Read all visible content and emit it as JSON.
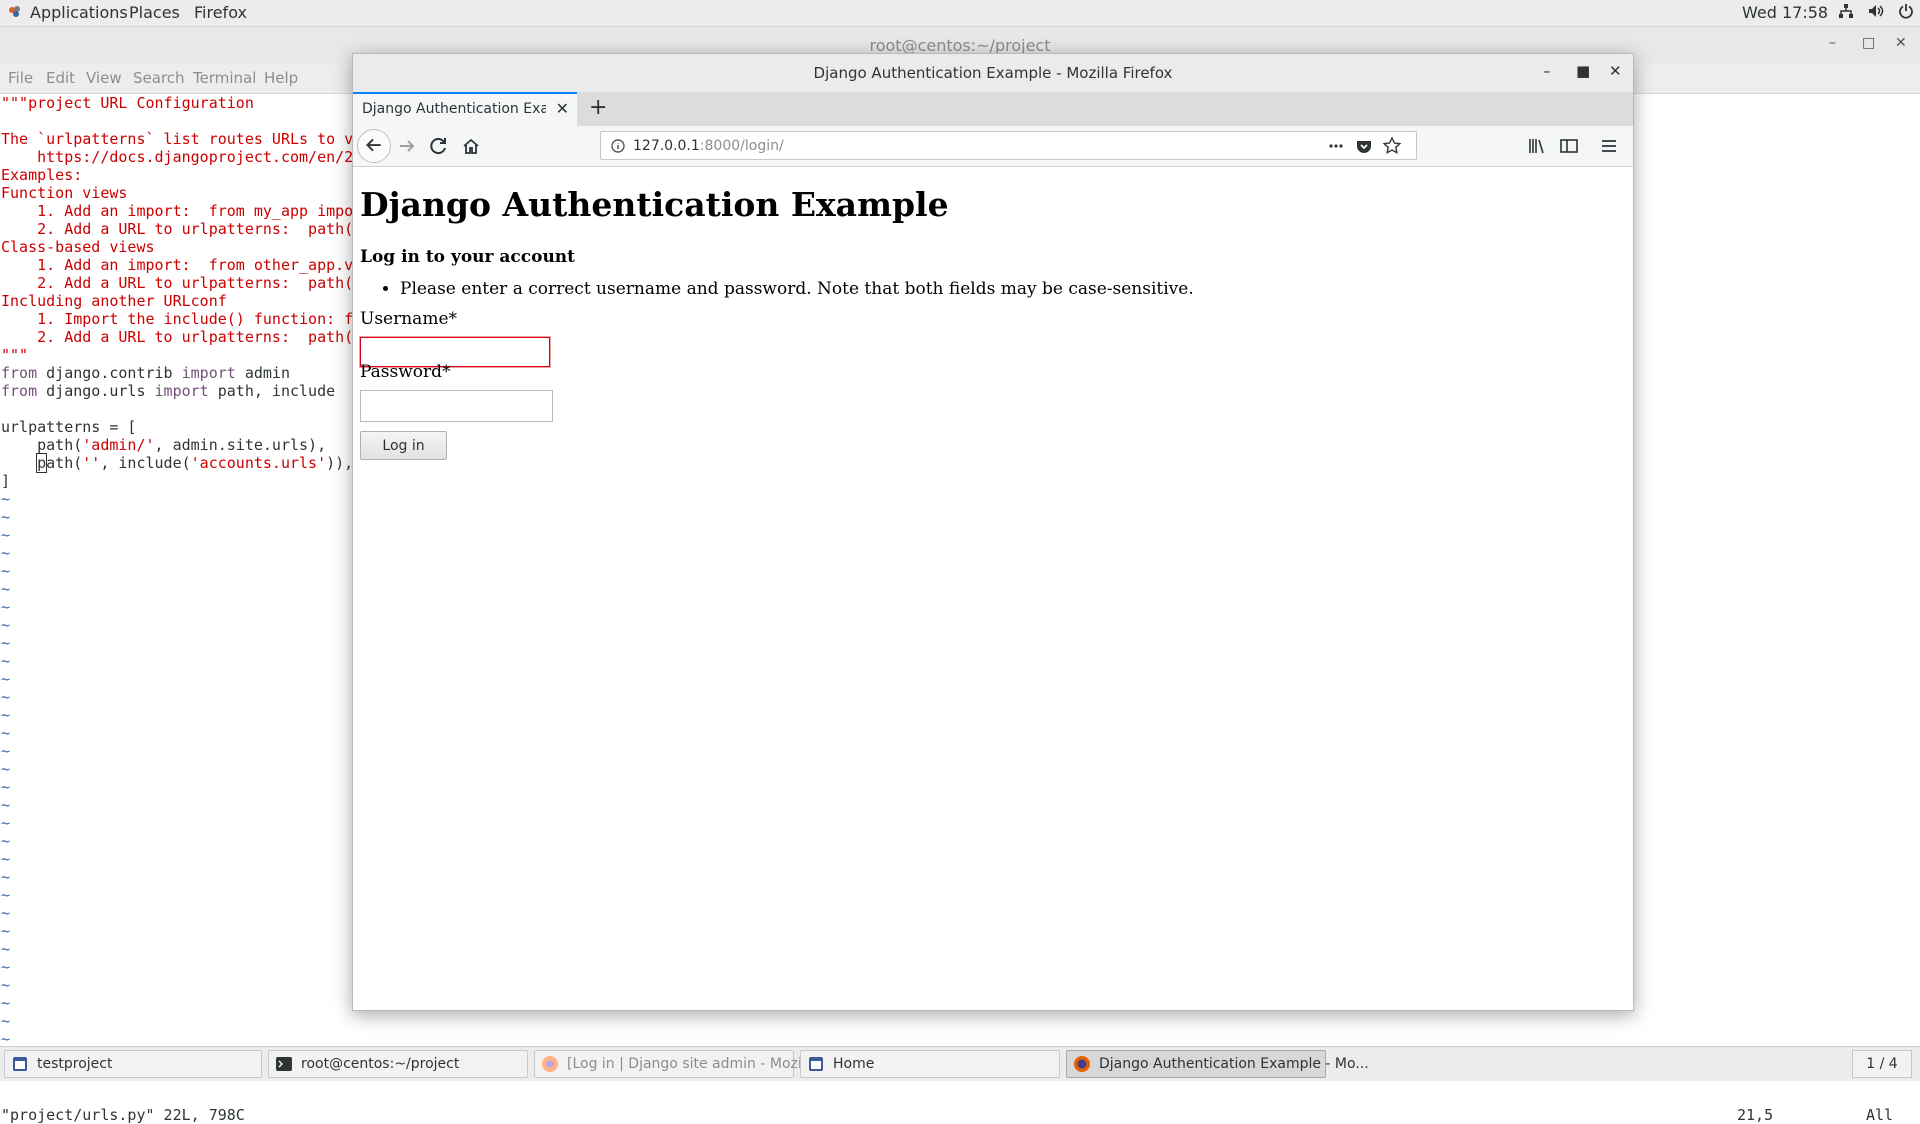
{
  "top_panel": {
    "applications": "Applications",
    "places": "Places",
    "firefox": "Firefox",
    "clock": "Wed 17:58",
    "tray_icons": [
      "network-icon",
      "volume-icon",
      "power-icon"
    ]
  },
  "terminal": {
    "title": "root@centos:~/project",
    "menu": [
      "File",
      "Edit",
      "View",
      "Search",
      "Terminal",
      "Help"
    ],
    "lines": [
      "\"\"\"project URL Configuration",
      "",
      "The `urlpatterns` list routes URLs to v",
      "    https://docs.djangoproject.com/en/2",
      "Examples:",
      "Function views",
      "    1. Add an import:  from my_app impo",
      "    2. Add a URL to urlpatterns:  path(",
      "Class-based views",
      "    1. Add an import:  from other_app.v",
      "    2. Add a URL to urlpatterns:  path(",
      "Including another URLconf",
      "    1. Import the include() function: f",
      "    2. Add a URL to urlpatterns:  path(",
      "\"\"\""
    ],
    "code": {
      "l1_from": "from",
      "l1_mod": " django.contrib ",
      "l1_import": "import",
      "l1_name": " admin",
      "l2_from": "from",
      "l2_mod": " django.urls ",
      "l2_import": "import",
      "l2_name": " path, include",
      "l4": "urlpatterns = [",
      "l5_a": "    path(",
      "l5_str": "'admin/'",
      "l5_b": ", admin.site.urls),",
      "l6_indent": "    ",
      "l6_cursor": "p",
      "l6_a": "ath(",
      "l6_str1": "''",
      "l6_b": ", include(",
      "l6_str2": "'accounts.urls'",
      "l6_c": ")),",
      "l7": "]"
    },
    "tilde": "~",
    "status_file": "\"project/urls.py\" 22L, 798C",
    "status_pos": "21,5",
    "status_scroll": "All"
  },
  "firefox": {
    "window_title": "Django Authentication Example - Mozilla Firefox",
    "tab_label": "Django Authentication Example",
    "url_host": "127.0.0.1",
    "url_path": ":8000/login/",
    "page": {
      "heading": "Django Authentication Example",
      "subheading": "Log in to your account",
      "error": "Please enter a correct username and password. Note that both fields may be case-sensitive.",
      "username_label": "Username*",
      "username_value": "",
      "password_label": "Password*",
      "password_value": "",
      "login_button": "Log in"
    }
  },
  "taskbar": {
    "items": [
      {
        "label": "testproject",
        "icon": "window-icon"
      },
      {
        "label": "root@centos:~/project",
        "icon": "terminal-icon"
      },
      {
        "label": "[Log in | Django site admin - Mozilla...",
        "icon": "firefox-icon"
      },
      {
        "label": "Home",
        "icon": "window-icon"
      },
      {
        "label": "Django Authentication Example - Mo...",
        "icon": "firefox-icon"
      }
    ],
    "workspace": "1 / 4"
  },
  "colors": {
    "code_red": "#cc0000",
    "code_purple": "#75507b",
    "tilde_blue": "#3465a4",
    "focus_blue": "#0a84ff",
    "error_border": "#d70022"
  }
}
